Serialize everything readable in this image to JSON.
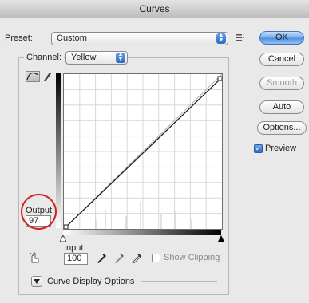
{
  "window": {
    "title": "Curves"
  },
  "preset": {
    "label": "Preset:",
    "value": "Custom"
  },
  "channel": {
    "label": "Channel:",
    "value": "Yellow"
  },
  "buttons": {
    "ok": "OK",
    "cancel": "Cancel",
    "smooth": "Smooth",
    "auto": "Auto",
    "options": "Options..."
  },
  "preview": {
    "label": "Preview",
    "checked": true
  },
  "output": {
    "label": "Output:",
    "value": "97"
  },
  "input": {
    "label": "Input:",
    "value": "100"
  },
  "show_clipping": {
    "label": "Show Clipping",
    "checked": false
  },
  "curve_display_options": {
    "label": "Curve Display Options"
  },
  "colors": {
    "accent": "#3b7ad8",
    "highlight_circle": "#d42020"
  }
}
